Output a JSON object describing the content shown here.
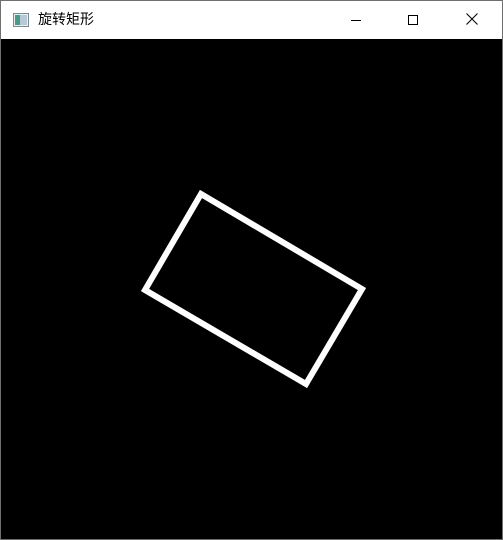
{
  "window": {
    "title": "旋转矩形",
    "icon": "app-window-icon",
    "controls": {
      "minimize": "minimize-icon",
      "maximize": "maximize-icon",
      "close": "close-icon"
    }
  },
  "canvas": {
    "background_color": "#000000",
    "shape": {
      "type": "rotated-rectangle",
      "stroke_color": "#ffffff",
      "fill": "none"
    }
  },
  "colors": {
    "titlebar": "#ffffff",
    "title_text": "#000000",
    "border": "#6f6f6f"
  }
}
